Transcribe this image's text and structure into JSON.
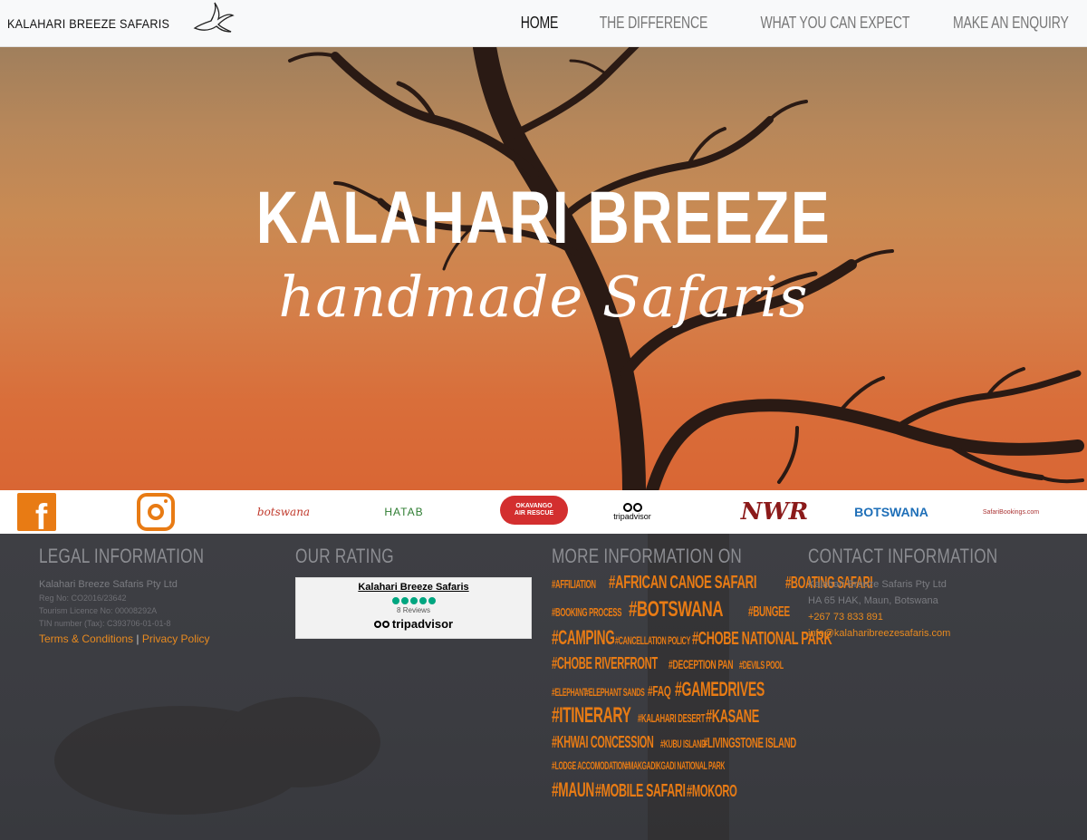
{
  "brand": {
    "name": "KALAHARI BREEZE SAFARIS",
    "logo_icon": "bird-icon"
  },
  "nav": {
    "items": [
      {
        "label": "HOME",
        "active": true
      },
      {
        "label": "THE DIFFERENCE",
        "active": false
      },
      {
        "label": "WHAT YOU CAN EXPECT",
        "active": false
      },
      {
        "label": "MAKE AN ENQUIRY",
        "active": false
      }
    ]
  },
  "hero": {
    "title": "KALAHARI BREEZE",
    "subtitle": "handmade Safaris"
  },
  "logos": {
    "facebook": "facebook-icon",
    "instagram": "instagram-icon",
    "botswana_tourism": "botswana",
    "hatab": "HATAB",
    "okavango": "OKAVANGO AIR RESCUE",
    "tripadvisor": "tripadvisor",
    "nwr": "NWR",
    "botswana_brand": "BOTSWANA",
    "safaribookings": "SafariBookings.com"
  },
  "footer": {
    "legal": {
      "title": "LEGAL INFORMATION",
      "company": "Kalahari Breeze Safaris Pty Ltd",
      "reg": "Reg No: CO2016/23642",
      "licence": "Tourism Licence No: 00008292A",
      "tin": "TIN number (Tax): C393706-01-01-8",
      "terms": "Terms & Conditions",
      "separator": "|",
      "privacy": "Privacy Policy"
    },
    "rating": {
      "title": "OUR RATING",
      "name": "Kalahari Breeze Safaris",
      "reviews": "8 Reviews",
      "provider": "tripadvisor"
    },
    "more_info": {
      "title": "MORE INFORMATION ON",
      "tags": [
        "#AFFILIATION",
        "#AFRICAN CANOE SAFARI",
        "#BOATING SAFARI",
        "#BOOKING PROCESS",
        "#BOTSWANA",
        "#BUNGEE",
        "#CAMPING",
        "#CANCELLATION POLICY",
        "#CHOBE NATIONAL PARK",
        "#CHOBE RIVERFRONT",
        "#DECEPTION PAN",
        "#DEVILS POOL",
        "#ELEPHANT",
        "#ELEPHANT SANDS",
        "#FAQ",
        "#GAMEDRIVES",
        "#ITINERARY",
        "#KALAHARI DESERT",
        "#KASANE",
        "#KHWAI CONCESSION",
        "#KUBU ISLAND",
        "#LIVINGSTONE ISLAND",
        "#LODGE ACCOMODATION",
        "#MAKGADIKGADI NATIONAL PARK",
        "#MAUN",
        "#MOBILE SAFARI",
        "#MOKORO"
      ]
    },
    "contact": {
      "title": "CONTACT INFORMATION",
      "company": "Kalahari Breeze Safaris Pty Ltd",
      "address": "HA 65 HAK, Maun, Botswana",
      "phone": "+267 73 833 891",
      "email": "info@kalaharibreezesafaris.com"
    }
  },
  "colors": {
    "accent": "#e87b14",
    "footer_bg": "#3b3c41",
    "nav_bg": "#f8f9fa"
  }
}
